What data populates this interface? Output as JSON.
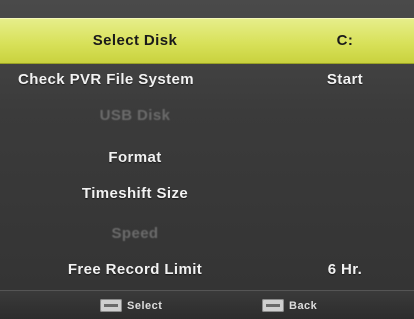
{
  "menu": {
    "items": [
      {
        "label": "Select Disk",
        "value": "C:",
        "state": "selected"
      },
      {
        "label": "Check PVR File System",
        "value": "Start",
        "state": "normal"
      },
      {
        "label": "USB Disk",
        "value": "",
        "state": "disabled"
      },
      {
        "label": "Format",
        "value": "",
        "state": "normal"
      },
      {
        "label": "Timeshift Size",
        "value": "",
        "state": "normal"
      },
      {
        "label": "Speed",
        "value": "",
        "state": "disabled"
      },
      {
        "label": "Free Record Limit",
        "value": "6 Hr.",
        "state": "normal"
      }
    ]
  },
  "footer": {
    "select_hint": {
      "icon": "enter-key-icon",
      "label": "Select"
    },
    "back_hint": {
      "icon": "menu-key-icon",
      "label": "Back"
    }
  },
  "colors": {
    "highlight": "#d8e15a",
    "text": "#f2f2f2",
    "disabled_text": "#6b6b6b",
    "background": "#3b3b3b"
  }
}
